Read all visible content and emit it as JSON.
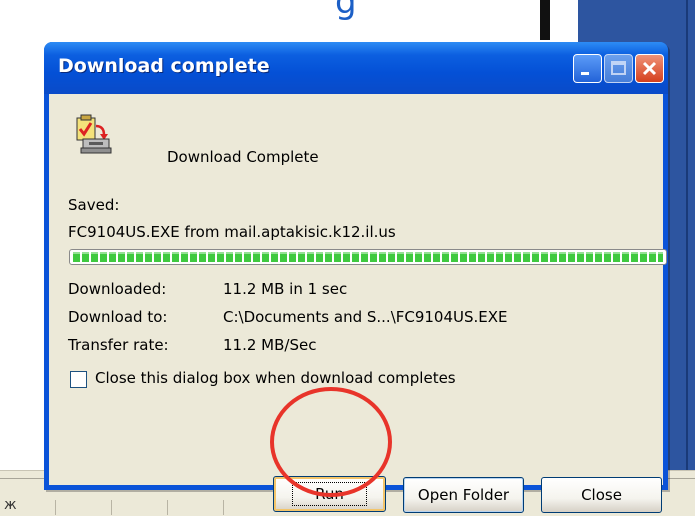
{
  "background": {
    "top_fragment": "g",
    "taskbar_glyph": "ж"
  },
  "dialog": {
    "title": "Download complete",
    "message": "Download Complete",
    "saved_label": "Saved:",
    "saved_value": "FC9104US.EXE from mail.aptakisic.k12.il.us",
    "progress": 1.0,
    "rows": [
      {
        "label": "Downloaded:",
        "value": "11.2 MB in 1 sec"
      },
      {
        "label": "Download to:",
        "value": "C:\\Documents and S...\\FC9104US.EXE"
      },
      {
        "label": "Transfer rate:",
        "value": "11.2 MB/Sec"
      }
    ],
    "checkbox_label": "Close this dialog box when download completes",
    "checkbox_checked": false,
    "buttons": {
      "run": "Run",
      "open_folder": "Open Folder",
      "close": "Close"
    }
  },
  "colors": {
    "titlebar": "#0450d6",
    "client_bg": "#ece9d8",
    "progress_fill": "#3fc93f",
    "annotation": "#e8342a"
  },
  "icons": {
    "download_complete": "download-complete-icon",
    "minimize": "minimize-icon",
    "maximize": "maximize-icon",
    "close": "close-icon"
  }
}
